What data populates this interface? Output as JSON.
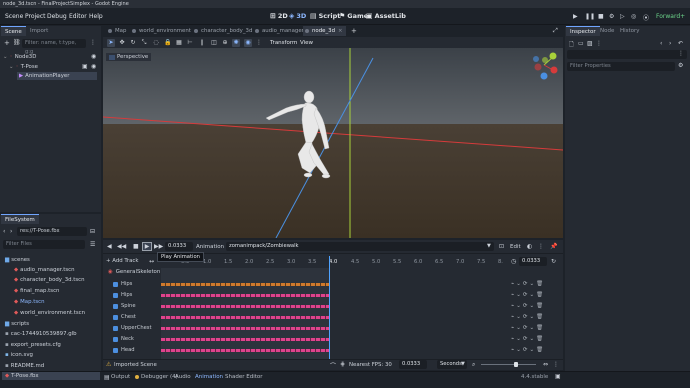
{
  "window": {
    "title": "node_3d.tscn - FinalProjectSimplex - Godot Engine"
  },
  "menu": [
    "Scene",
    "Project",
    "Debug",
    "Editor",
    "Help"
  ],
  "workspaces": [
    {
      "icon": "2d-icon",
      "label": "2D"
    },
    {
      "icon": "3d-icon",
      "label": "3D"
    },
    {
      "icon": "script-icon",
      "label": "Script"
    },
    {
      "icon": "game-icon",
      "label": "Game"
    },
    {
      "icon": "assetlib-icon",
      "label": "AssetLib"
    }
  ],
  "renderer": "Forward+",
  "scene_dock": {
    "tabs": [
      "Scene",
      "Import"
    ],
    "filter_placeholder": "Filter: name, t:type, g:g",
    "nodes": [
      "Node3D",
      "T-Pose",
      "AnimationPlayer"
    ]
  },
  "filesystem": {
    "tab": "FileSystem",
    "path": "res://T-Pose.fbx",
    "filter_placeholder": "Filter Files",
    "items": [
      {
        "type": "folder",
        "label": "scenes"
      },
      {
        "type": "file",
        "label": "audio_manager.tscn"
      },
      {
        "type": "file",
        "label": "character_body_3d.tscn"
      },
      {
        "type": "file",
        "label": "final_map.tscn"
      },
      {
        "type": "file",
        "label": "Map.tscn"
      },
      {
        "type": "file",
        "label": "world_environment.tscn"
      },
      {
        "type": "folder",
        "label": "scripts"
      },
      {
        "type": "file",
        "label": "cac-1744910539897.glb"
      },
      {
        "type": "file",
        "label": "export_presets.cfg"
      },
      {
        "type": "file",
        "label": "icon.svg"
      },
      {
        "type": "file",
        "label": "README.md"
      },
      {
        "type": "file",
        "label": "T-Pose.fbx"
      }
    ]
  },
  "editor_tabs": [
    "Map",
    "world_environment",
    "character_body_3d",
    "audio_manager",
    "node_3d"
  ],
  "viewport": {
    "menu": [
      "Transform",
      "View"
    ],
    "perspective_label": "Perspective"
  },
  "animation": {
    "time": "0.0333",
    "label": "Animation",
    "current": "zomanimpack/Zombiewalk",
    "edit_label": "Edit",
    "tooltip": "Play Animation",
    "add_track": "+ Add Track",
    "length": "0.0333",
    "ticks": [
      "0.5",
      "1.0",
      "1.5",
      "2.0",
      "2.5",
      "3.0",
      "3.5",
      "4.0",
      "4.5",
      "5.0",
      "5.5",
      "6.0",
      "6.5",
      "7.0",
      "7.5",
      "8."
    ],
    "group": "GeneralSkeleton",
    "tracks": [
      "Hips",
      "Hips",
      "Spine",
      "Chest",
      "UpperChest",
      "Neck",
      "Head"
    ],
    "footer": {
      "imported_scene": "Imported Scene",
      "snap": "Nearest FPS: 30",
      "step": "0.0333",
      "unit": "Seconds"
    }
  },
  "bottom_tabs": [
    "Output",
    "Debugger (4)",
    "Audio",
    "Animation",
    "Shader Editor"
  ],
  "version": "4.4.stable",
  "inspector": {
    "tabs": [
      "Inspector",
      "Node",
      "History"
    ],
    "filter_placeholder": "Filter Properties"
  },
  "colors": {
    "accent": "#4c8fe0",
    "keyframe_pink": "#e0438c",
    "keyframe_orange": "#d07a2c",
    "ground": "#3b3226",
    "x_axis": "#d63b3b",
    "y_axis": "#a8d13a",
    "z_axis": "#4a90e2"
  }
}
